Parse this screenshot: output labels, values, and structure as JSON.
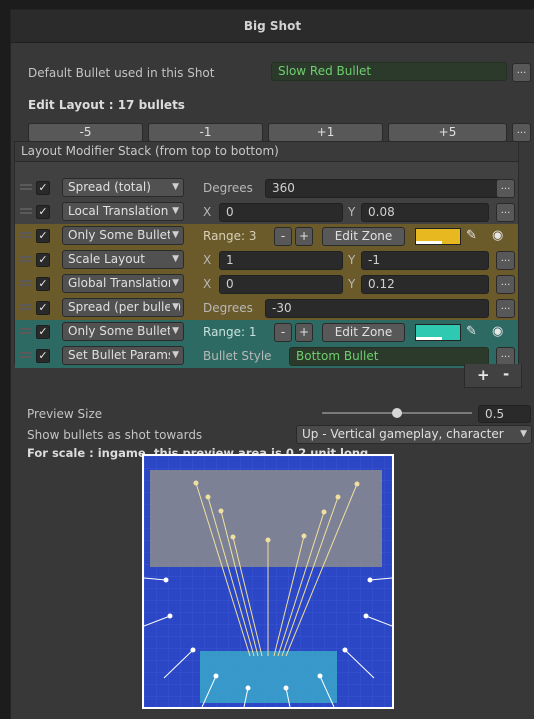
{
  "window": {
    "title": "Big Shot"
  },
  "default_bullet": {
    "label": "Default Bullet used in this Shot",
    "value": "Slow Red Bullet",
    "more": "..."
  },
  "edit_layout": {
    "label": "Edit Layout : 17 bullets",
    "buttons": [
      "-5",
      "-1",
      "+1",
      "+5"
    ],
    "more": "..."
  },
  "stack": {
    "header": "Layout Modifier Stack (from top to bottom)",
    "check": "✓",
    "more": "...",
    "rows": [
      {
        "type": "Spread (total)",
        "label1": "Degrees",
        "value1": "360"
      },
      {
        "type": "Local Translation",
        "label1": "X",
        "value1": "0",
        "label2": "Y",
        "value2": "0.08"
      },
      {
        "type": "Only Some Bullets",
        "range": "Range: 3",
        "minus": "-",
        "plus": "+",
        "edit": "Edit Zone",
        "color": "#e8b820"
      },
      {
        "type": "Scale Layout",
        "label1": "X",
        "value1": "1",
        "label2": "Y",
        "value2": "-1"
      },
      {
        "type": "Global Translation",
        "label1": "X",
        "value1": "0",
        "label2": "Y",
        "value2": "0.12"
      },
      {
        "type": "Spread (per bullet)",
        "label1": "Degrees",
        "value1": "-30"
      },
      {
        "type": "Only Some Bullets",
        "range": "Range: 1",
        "minus": "-",
        "plus": "+",
        "edit": "Edit Zone",
        "color": "#2ec9b0"
      },
      {
        "type": "Set Bullet Params",
        "label1": "Bullet Style",
        "value1": "Bottom Bullet"
      }
    ],
    "add": "+",
    "remove": "-"
  },
  "preview": {
    "size_label": "Preview Size",
    "size_value": "0.5",
    "size_fraction": 0.5,
    "direction_label": "Show bullets as shot towards",
    "direction_value": "Up - Vertical gameplay, character",
    "scale_note": "For scale : ingame, this preview area is 0.2 unit long."
  },
  "colors": {
    "yellow_zone": "#6b5a2a",
    "teal_zone": "#2e6a64",
    "preview_bg": "#2b47c5",
    "bullet_style_text": "#6fcf6f"
  }
}
